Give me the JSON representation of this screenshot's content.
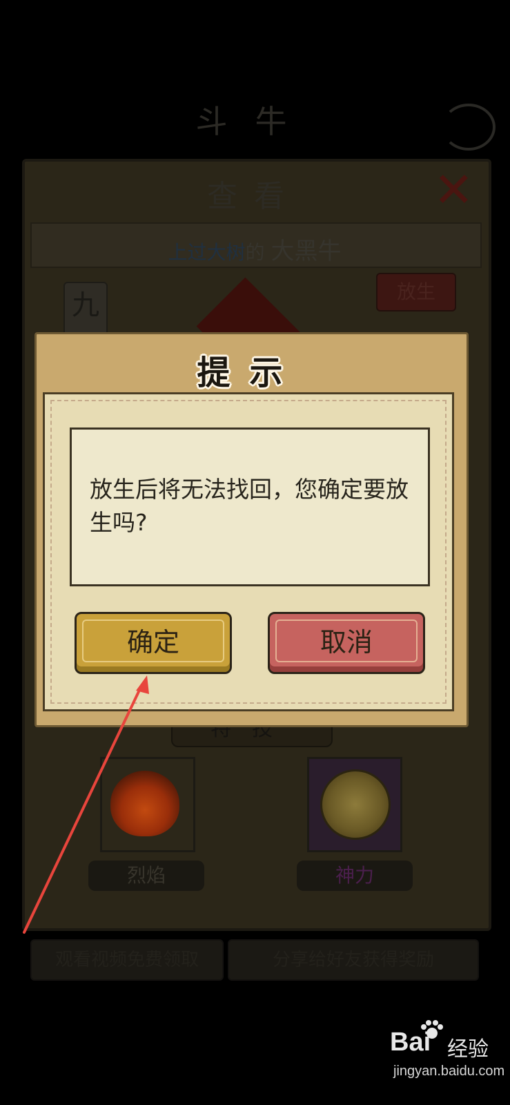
{
  "background": {
    "screen_title": "斗牛",
    "panel_title": "查看",
    "owner_name": "上过大树",
    "owner_suffix": "的",
    "animal_name": "大黑牛",
    "rank": "九",
    "release_label": "放生",
    "skills_header": "特技",
    "skills": [
      {
        "label": "烈焰",
        "icon": "flame-icon"
      },
      {
        "label": "神力",
        "icon": "golden-orb-icon"
      }
    ],
    "bottom_buttons": [
      "观看视频免费领取",
      "分享给好友获得奖励"
    ]
  },
  "dialog": {
    "title": "提示",
    "message": "放生后将无法找回，您确定要放生吗?",
    "confirm_label": "确定",
    "cancel_label": "取消"
  },
  "watermark": {
    "brand": "Bai",
    "brand_suffix": "经验",
    "url": "jingyan.baidu.com"
  },
  "colors": {
    "confirm": "#c9a13a",
    "cancel": "#c6635f",
    "dialog_bg": "#c9a96e",
    "annotation_arrow": "#e8453c"
  }
}
